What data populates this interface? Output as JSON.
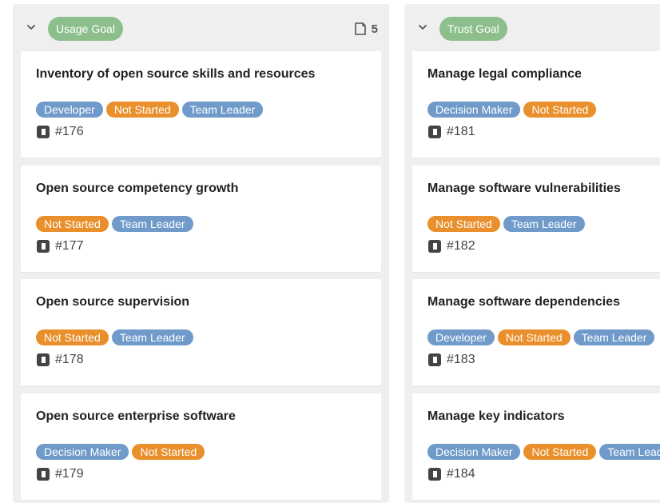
{
  "columns": [
    {
      "goal": "Usage Goal",
      "count": "5",
      "cards": [
        {
          "title": "Inventory of open source skills and resources",
          "tags": [
            "Developer",
            "Not Started",
            "Team Leader"
          ],
          "id": "#176"
        },
        {
          "title": "Open source competency growth",
          "tags": [
            "Not Started",
            "Team Leader"
          ],
          "id": "#177"
        },
        {
          "title": "Open source supervision",
          "tags": [
            "Not Started",
            "Team Leader"
          ],
          "id": "#178"
        },
        {
          "title": "Open source enterprise software",
          "tags": [
            "Decision Maker",
            "Not Started"
          ],
          "id": "#179"
        }
      ]
    },
    {
      "goal": "Trust Goal",
      "cards": [
        {
          "title": "Manage legal compliance",
          "tags": [
            "Decision Maker",
            "Not Started"
          ],
          "id": "#181"
        },
        {
          "title": "Manage software vulnerabilities",
          "tags": [
            "Not Started",
            "Team Leader"
          ],
          "id": "#182"
        },
        {
          "title": "Manage software dependencies",
          "tags": [
            "Developer",
            "Not Started",
            "Team Leader"
          ],
          "id": "#183"
        },
        {
          "title": "Manage key indicators",
          "tags": [
            "Decision Maker",
            "Not Started",
            "Team Leader"
          ],
          "id": "#184"
        }
      ]
    }
  ],
  "icons": {
    "collapse": "chevron-down-icon",
    "count": "card-count-icon",
    "card_id": "card-id-icon"
  },
  "colors": {
    "goal_pill": "#8dbf8c",
    "role_tag": "#6f9ac9",
    "status_tag": "#e98f2b",
    "column_bg": "#efefef"
  }
}
